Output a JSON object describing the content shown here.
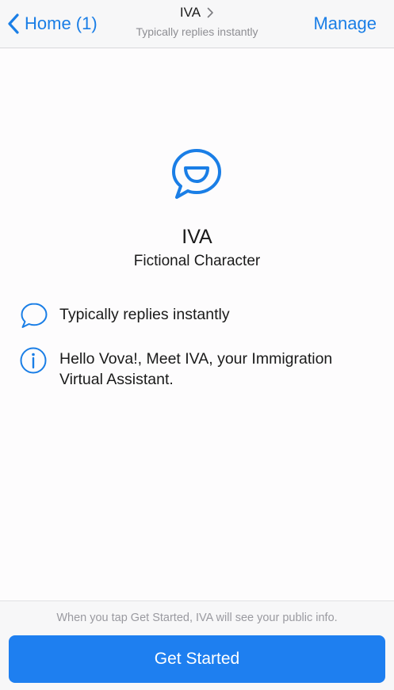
{
  "colors": {
    "accent": "#1a7ee6",
    "button_bg": "#1e7ff0",
    "button_text": "#ffffff",
    "navbar_bg": "#f7f7f8",
    "secondary_text": "#8e8e93"
  },
  "navbar": {
    "back_icon": "chevron-left-icon",
    "back_label": "Home (1)",
    "title": "IVA",
    "title_icon": "chevron-right-icon",
    "subtitle": "Typically replies instantly",
    "manage_label": "Manage"
  },
  "profile": {
    "icon": "smiling-chat-bubble-icon",
    "name": "IVA",
    "category": "Fictional Character"
  },
  "info": {
    "replies": {
      "icon": "chat-bubble-icon",
      "text": "Typically replies instantly"
    },
    "intro": {
      "icon": "info-icon",
      "line1": "Hello Vova!, Meet IVA, your Immigration",
      "line2": "Virtual Assistant."
    }
  },
  "footer": {
    "disclaimer": "When you tap Get Started, IVA will see your public info.",
    "button_label": "Get Started"
  }
}
